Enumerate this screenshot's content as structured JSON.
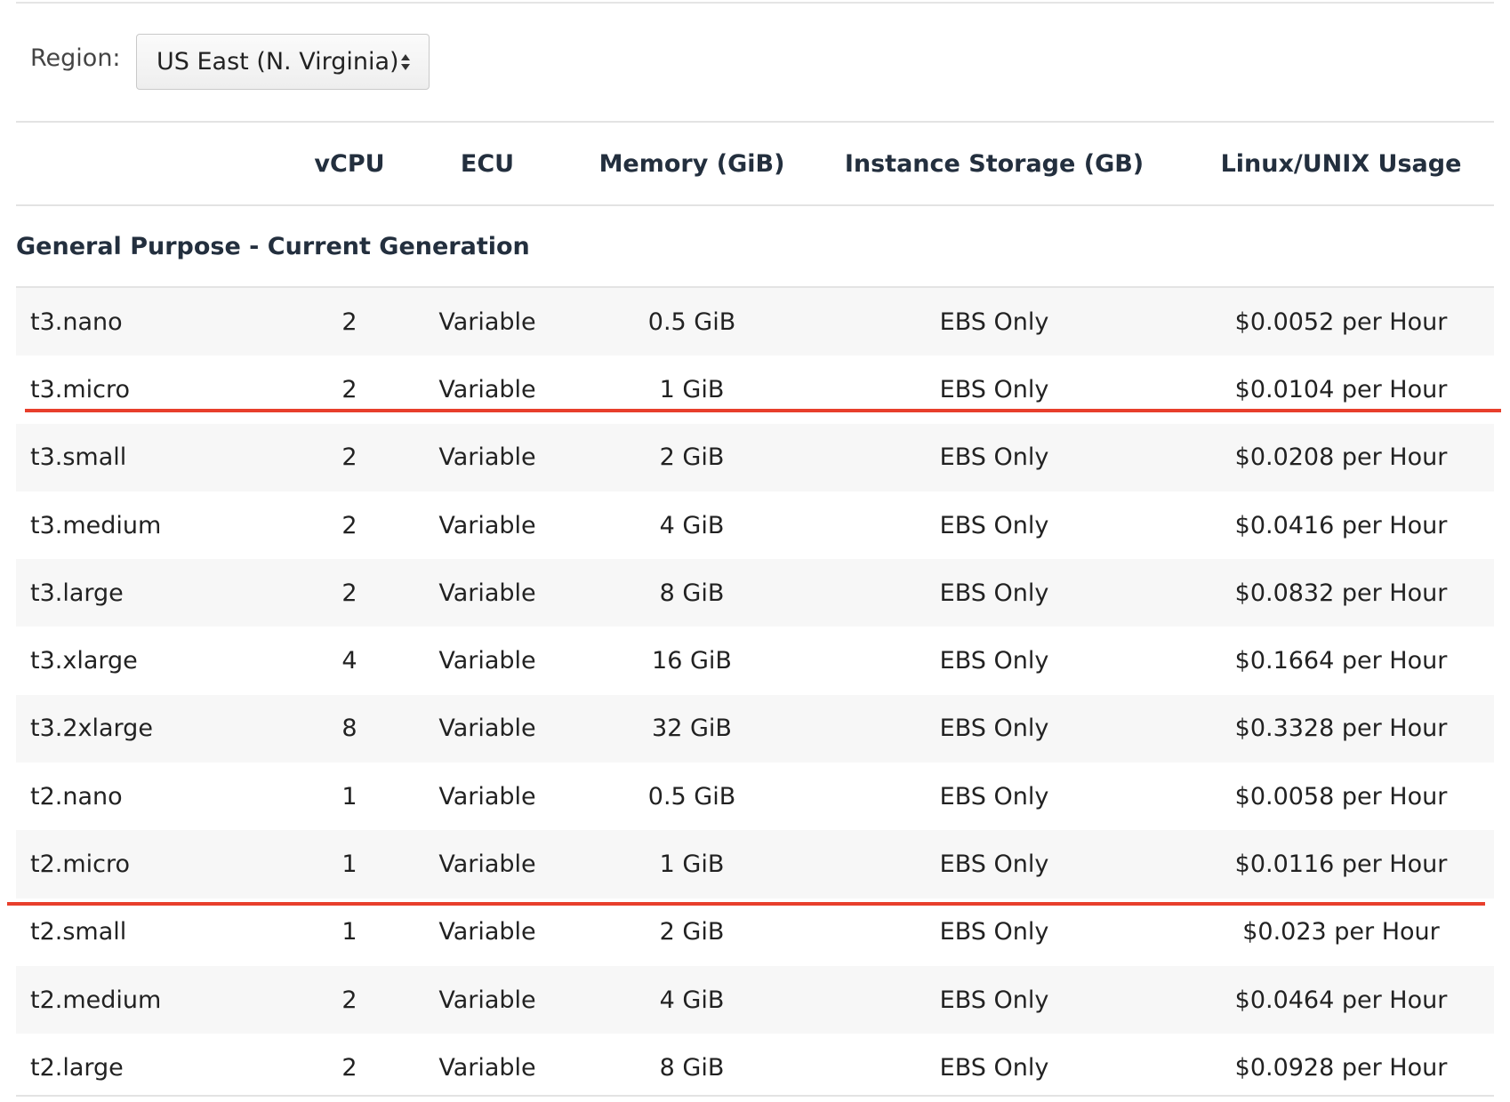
{
  "region": {
    "label": "Region:",
    "selected": "US East (N. Virginia)"
  },
  "table": {
    "headers": {
      "name": "",
      "vcpu": "vCPU",
      "ecu": "ECU",
      "memory": "Memory (GiB)",
      "storage": "Instance Storage (GB)",
      "price": "Linux/UNIX Usage"
    },
    "section_title": "General Purpose - Current Generation",
    "rows": [
      {
        "name": "t3.nano",
        "vcpu": "2",
        "ecu": "Variable",
        "memory": "0.5 GiB",
        "storage": "EBS Only",
        "price": "$0.0052 per Hour"
      },
      {
        "name": "t3.micro",
        "vcpu": "2",
        "ecu": "Variable",
        "memory": "1 GiB",
        "storage": "EBS Only",
        "price": "$0.0104 per Hour"
      },
      {
        "name": "t3.small",
        "vcpu": "2",
        "ecu": "Variable",
        "memory": "2 GiB",
        "storage": "EBS Only",
        "price": "$0.0208 per Hour"
      },
      {
        "name": "t3.medium",
        "vcpu": "2",
        "ecu": "Variable",
        "memory": "4 GiB",
        "storage": "EBS Only",
        "price": "$0.0416 per Hour"
      },
      {
        "name": "t3.large",
        "vcpu": "2",
        "ecu": "Variable",
        "memory": "8 GiB",
        "storage": "EBS Only",
        "price": "$0.0832 per Hour"
      },
      {
        "name": "t3.xlarge",
        "vcpu": "4",
        "ecu": "Variable",
        "memory": "16 GiB",
        "storage": "EBS Only",
        "price": "$0.1664 per Hour"
      },
      {
        "name": "t3.2xlarge",
        "vcpu": "8",
        "ecu": "Variable",
        "memory": "32 GiB",
        "storage": "EBS Only",
        "price": "$0.3328 per Hour"
      },
      {
        "name": "t2.nano",
        "vcpu": "1",
        "ecu": "Variable",
        "memory": "0.5 GiB",
        "storage": "EBS Only",
        "price": "$0.0058 per Hour"
      },
      {
        "name": "t2.micro",
        "vcpu": "1",
        "ecu": "Variable",
        "memory": "1 GiB",
        "storage": "EBS Only",
        "price": "$0.0116 per Hour"
      },
      {
        "name": "t2.small",
        "vcpu": "1",
        "ecu": "Variable",
        "memory": "2 GiB",
        "storage": "EBS Only",
        "price": "$0.023 per Hour"
      },
      {
        "name": "t2.medium",
        "vcpu": "2",
        "ecu": "Variable",
        "memory": "4 GiB",
        "storage": "EBS Only",
        "price": "$0.0464 per Hour"
      },
      {
        "name": "t2.large",
        "vcpu": "2",
        "ecu": "Variable",
        "memory": "8 GiB",
        "storage": "EBS Only",
        "price": "$0.0928 per Hour"
      }
    ]
  },
  "colors": {
    "annotation_underline": "#e83f2c",
    "stripe": "#f7f7f7",
    "text": "#232f3e"
  },
  "annotations": {
    "underlined_rows": [
      "t3.micro",
      "t2.micro"
    ]
  }
}
